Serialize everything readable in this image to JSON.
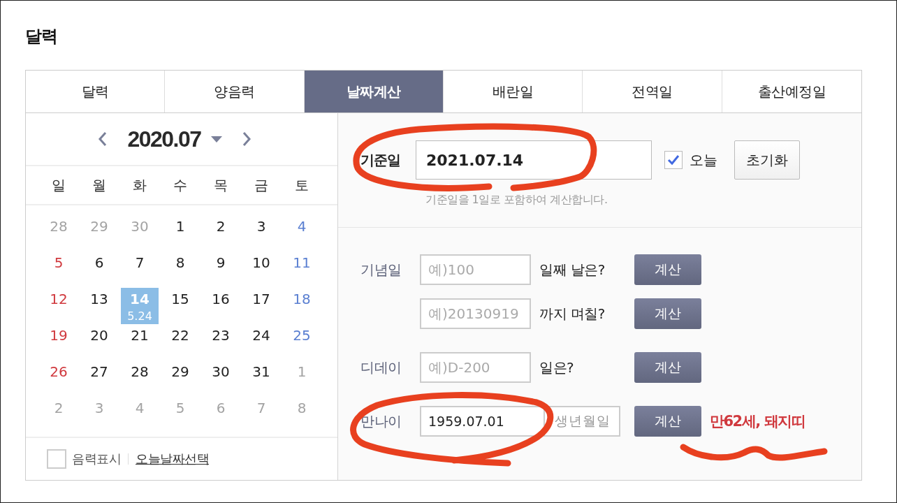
{
  "page_title": "달력",
  "tabs": [
    {
      "label": "달력",
      "selected": false
    },
    {
      "label": "양음력",
      "selected": false
    },
    {
      "label": "날짜계산",
      "selected": true
    },
    {
      "label": "배란일",
      "selected": false
    },
    {
      "label": "전역일",
      "selected": false
    },
    {
      "label": "출산예정일",
      "selected": false
    }
  ],
  "calendar": {
    "month": "2020.07",
    "weekdays": [
      "일",
      "월",
      "화",
      "수",
      "목",
      "금",
      "토"
    ],
    "weeks": [
      [
        {
          "day": "28",
          "kind": "other",
          "selected": false
        },
        {
          "day": "29",
          "kind": "other",
          "selected": false
        },
        {
          "day": "30",
          "kind": "other",
          "selected": false
        },
        {
          "day": "1",
          "kind": "weekday",
          "selected": false
        },
        {
          "day": "2",
          "kind": "weekday",
          "selected": false
        },
        {
          "day": "3",
          "kind": "weekday",
          "selected": false
        },
        {
          "day": "4",
          "kind": "saturday",
          "selected": false
        }
      ],
      [
        {
          "day": "5",
          "kind": "sunday",
          "selected": false
        },
        {
          "day": "6",
          "kind": "weekday",
          "selected": false
        },
        {
          "day": "7",
          "kind": "weekday",
          "selected": false
        },
        {
          "day": "8",
          "kind": "weekday",
          "selected": false
        },
        {
          "day": "9",
          "kind": "weekday",
          "selected": false
        },
        {
          "day": "10",
          "kind": "weekday",
          "selected": false
        },
        {
          "day": "11",
          "kind": "saturday",
          "selected": false
        }
      ],
      [
        {
          "day": "12",
          "kind": "sunday",
          "selected": false
        },
        {
          "day": "13",
          "kind": "weekday",
          "selected": false
        },
        {
          "day": "14",
          "kind": "weekday",
          "selected": true,
          "lunar": "5.24"
        },
        {
          "day": "15",
          "kind": "weekday",
          "selected": false
        },
        {
          "day": "16",
          "kind": "weekday",
          "selected": false
        },
        {
          "day": "17",
          "kind": "weekday",
          "selected": false
        },
        {
          "day": "18",
          "kind": "saturday",
          "selected": false
        }
      ],
      [
        {
          "day": "19",
          "kind": "sunday",
          "selected": false
        },
        {
          "day": "20",
          "kind": "weekday",
          "selected": false
        },
        {
          "day": "21",
          "kind": "weekday",
          "selected": false
        },
        {
          "day": "22",
          "kind": "weekday",
          "selected": false
        },
        {
          "day": "23",
          "kind": "weekday",
          "selected": false
        },
        {
          "day": "24",
          "kind": "weekday",
          "selected": false
        },
        {
          "day": "25",
          "kind": "saturday",
          "selected": false
        }
      ],
      [
        {
          "day": "26",
          "kind": "sunday",
          "selected": false
        },
        {
          "day": "27",
          "kind": "weekday",
          "selected": false
        },
        {
          "day": "28",
          "kind": "weekday",
          "selected": false
        },
        {
          "day": "29",
          "kind": "weekday",
          "selected": false
        },
        {
          "day": "30",
          "kind": "weekday",
          "selected": false
        },
        {
          "day": "31",
          "kind": "weekday",
          "selected": false
        },
        {
          "day": "1",
          "kind": "other",
          "selected": false
        }
      ],
      [
        {
          "day": "2",
          "kind": "other",
          "selected": false
        },
        {
          "day": "3",
          "kind": "other",
          "selected": false
        },
        {
          "day": "4",
          "kind": "other",
          "selected": false
        },
        {
          "day": "5",
          "kind": "other",
          "selected": false
        },
        {
          "day": "6",
          "kind": "other",
          "selected": false
        },
        {
          "day": "7",
          "kind": "other",
          "selected": false
        },
        {
          "day": "8",
          "kind": "other",
          "selected": false
        }
      ]
    ],
    "lunar_toggle": {
      "label": "음력표시",
      "checked": false
    },
    "today_link": "오늘날짜선택"
  },
  "base_date": {
    "label": "기준일",
    "value": "2021.07.14",
    "today": {
      "label": "오늘",
      "checked": true
    },
    "reset_button": "초기화",
    "hint": "기준일을 1일로 포함하여 계산합니다."
  },
  "calculators": [
    {
      "kind": "question",
      "label": "기념일",
      "placeholder": "예)100",
      "question": "일째 날은?",
      "button": "계산"
    },
    {
      "kind": "question",
      "placeholder": "예)20130919",
      "question": "까지 며칠?",
      "button": "계산"
    },
    {
      "kind": "question",
      "label": "디데이",
      "placeholder": "예)D-200",
      "question": "일은?",
      "button": "계산"
    },
    {
      "kind": "birth",
      "label": "만나이",
      "value": "1959.07.01",
      "hint": "생년월일",
      "button": "계산",
      "result": "만62세, 돼지띠"
    }
  ]
}
